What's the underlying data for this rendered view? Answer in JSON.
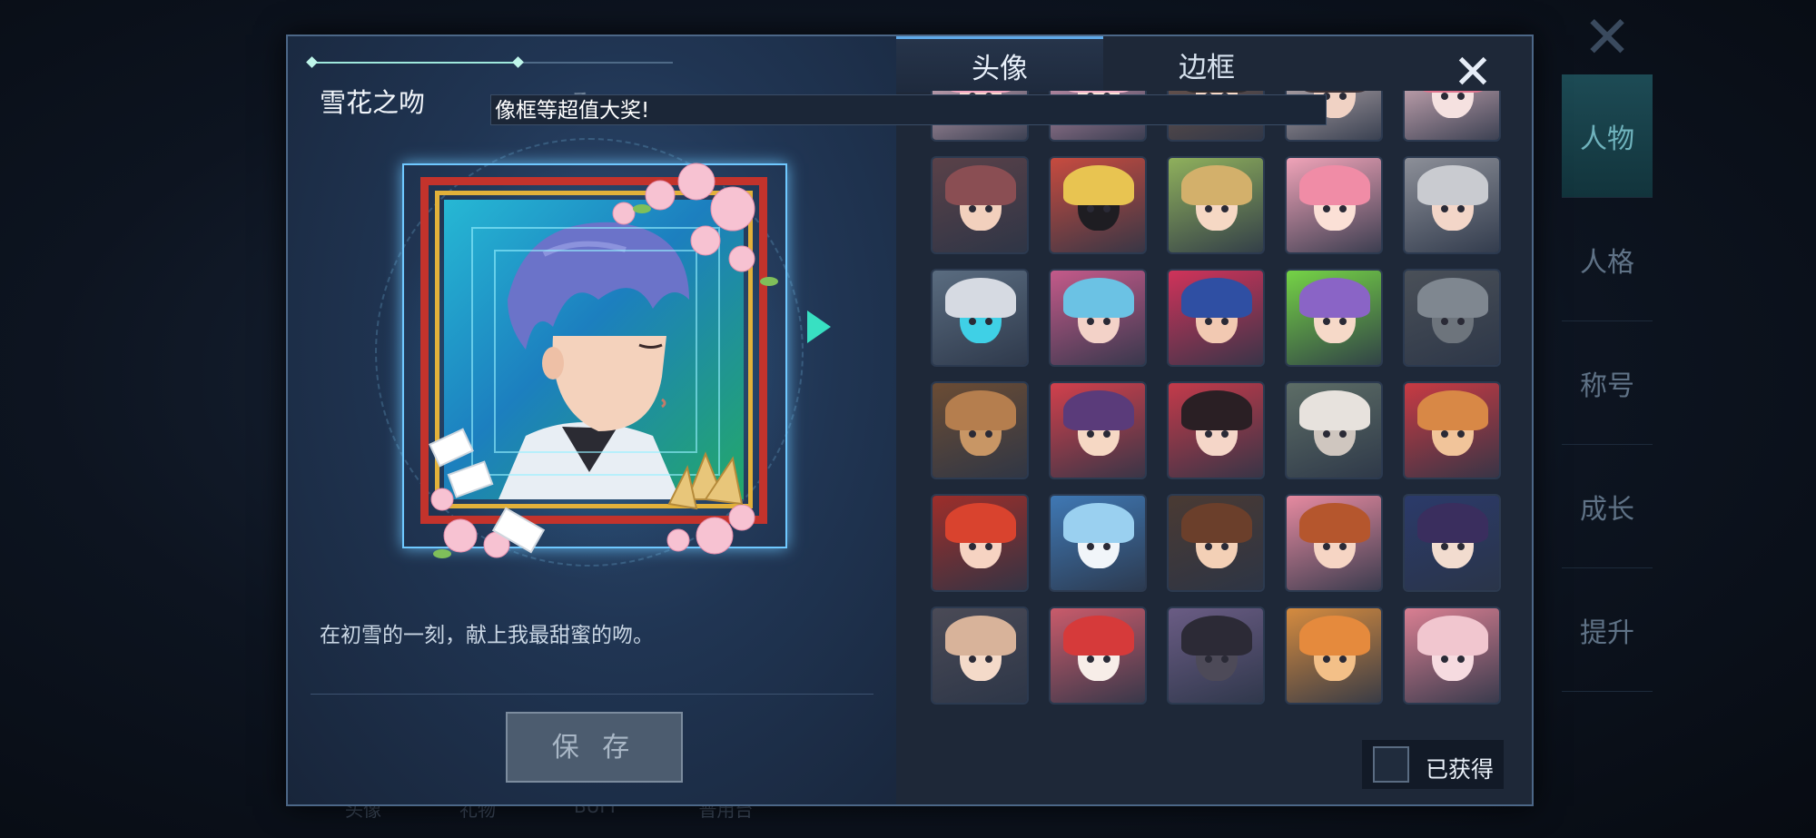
{
  "background": {
    "sidebar_items": [
      "人物",
      "人格",
      "称号",
      "成长",
      "提升"
    ],
    "bottom_tabs": [
      "头像",
      "礼物",
      "BUFF",
      "普用台"
    ]
  },
  "modal": {
    "item_title": "雪花之吻",
    "item_title_secondary": "…ゑ",
    "banner_text": "像框等超值大奖!",
    "description": "在初雪的一刻，献上我最甜蜜的吻。",
    "save_label": "保 存",
    "tabs": [
      {
        "label": "头像",
        "active": true
      },
      {
        "label": "边框",
        "active": false
      }
    ],
    "owned_filter_label": "已获得",
    "owned_filter_checked": false
  },
  "colors": {
    "accent_teal": "#38e0c2",
    "frame_red": "#c3332c",
    "frame_gold": "#e2b13a"
  },
  "avatars": [
    {
      "hair": "#f2a7c1",
      "face": "#f9d7d0",
      "bg": "#f4c5d4"
    },
    {
      "hair": "#f1b3c9",
      "face": "#fbe2d8",
      "bg": "#e7a7c4"
    },
    {
      "hair": "#2c2a2e",
      "face": "#f6d8c6",
      "bg": "#7a5b4d"
    },
    {
      "hair": "#3b3237",
      "face": "#f0d2c4",
      "bg": "#d9c6c6"
    },
    {
      "hair": "#e0748e",
      "face": "#f5e1e0",
      "bg": "#f6c8d2"
    },
    {
      "hair": "#8a4e53",
      "face": "#f2d0bd",
      "bg": "#5a4148"
    },
    {
      "hair": "#e8c451",
      "face": "#1e1d22",
      "bg": "#c74b3f"
    },
    {
      "hair": "#d3b06b",
      "face": "#f6d8c4",
      "bg": "#8fb05c"
    },
    {
      "hair": "#f08ca6",
      "face": "#fbe0d6",
      "bg": "#f0a3b8"
    },
    {
      "hair": "#c9cbd0",
      "face": "#f3d6c8",
      "bg": "#8c8f98"
    },
    {
      "hair": "#d6dae2",
      "face": "#3fd0e6",
      "bg": "#5a6c80"
    },
    {
      "hair": "#6bc2e4",
      "face": "#f3d2c8",
      "bg": "#c45a8a"
    },
    {
      "hair": "#2f4fa3",
      "face": "#f2c9b2",
      "bg": "#d0335a"
    },
    {
      "hair": "#8a64c6",
      "face": "#f6d9c8",
      "bg": "#75d346"
    },
    {
      "hair": "#7f8790",
      "face": "#6d747c",
      "bg": "#4a5058"
    },
    {
      "hair": "#b57e4e",
      "face": "#c89665",
      "bg": "#6b4c34"
    },
    {
      "hair": "#5a3b7a",
      "face": "#f6d8c4",
      "bg": "#d2404c"
    },
    {
      "hair": "#2a1f24",
      "face": "#f5d6c8",
      "bg": "#c43a4a"
    },
    {
      "hair": "#e7e2dd",
      "face": "#cfc6bf",
      "bg": "#5d6d66"
    },
    {
      "hair": "#d88846",
      "face": "#f1c49a",
      "bg": "#c83a43"
    },
    {
      "hair": "#d9432e",
      "face": "#f6d3c2",
      "bg": "#9d2e2a"
    },
    {
      "hair": "#9ad0f0",
      "face": "#f1f5f9",
      "bg": "#3f78b4"
    },
    {
      "hair": "#6b3f2b",
      "face": "#f3d0b6",
      "bg": "#4a3a33"
    },
    {
      "hair": "#b5562d",
      "face": "#f6d5c4",
      "bg": "#e68aa0"
    },
    {
      "hair": "#3a2e5e",
      "face": "#f2dccf",
      "bg": "#2b3a6a"
    },
    {
      "hair": "#d8b39a",
      "face": "#f4dac9",
      "bg": "#4a4a56"
    },
    {
      "hair": "#d63a3a",
      "face": "#f7ede8",
      "bg": "#c95b6b"
    },
    {
      "hair": "#2c2a36",
      "face": "#4d4a58",
      "bg": "#6a5c84"
    },
    {
      "hair": "#e58a3d",
      "face": "#f3c088",
      "bg": "#d58b3f"
    },
    {
      "hair": "#f1c6cf",
      "face": "#f6dbe0",
      "bg": "#d97f92"
    }
  ]
}
